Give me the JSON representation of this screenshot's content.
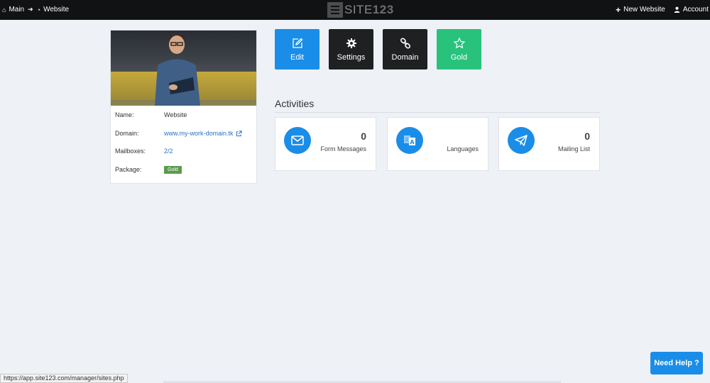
{
  "topbar": {
    "crumbs": [
      {
        "label": "Main",
        "icon": "home-icon"
      },
      {
        "label": "Website",
        "icon": "dashboard-icon"
      }
    ],
    "logo": {
      "text_a": "SITE",
      "text_b": "123"
    },
    "new_website": "New Website",
    "account": "Account"
  },
  "profile": {
    "rows": [
      {
        "label": "Name:",
        "value": "Website"
      },
      {
        "label": "Domain:",
        "value": "www.my-work-domain.tk"
      },
      {
        "label": "Mailboxes:",
        "value": "2/2"
      },
      {
        "label": "Package:",
        "value": "Gold"
      }
    ]
  },
  "actions": {
    "edit": "Edit",
    "settings": "Settings",
    "domain": "Domain",
    "gold": "Gold"
  },
  "activities": {
    "title": "Activities",
    "cards": [
      {
        "label": "Form Messages",
        "count": "0",
        "icon": "envelope-icon"
      },
      {
        "label": "Languages",
        "count": "",
        "icon": "translate-icon"
      },
      {
        "label": "Mailing List",
        "count": "0",
        "icon": "paper-plane-icon"
      }
    ]
  },
  "help_button": "Need Help ?",
  "status_url": "https://app.site123.com/manager/sites.php",
  "colors": {
    "primary": "#1a8de8",
    "dark": "#1f2022",
    "gold": "#28c27c",
    "badge": "#5a9b4c",
    "link": "#2a72c4"
  }
}
